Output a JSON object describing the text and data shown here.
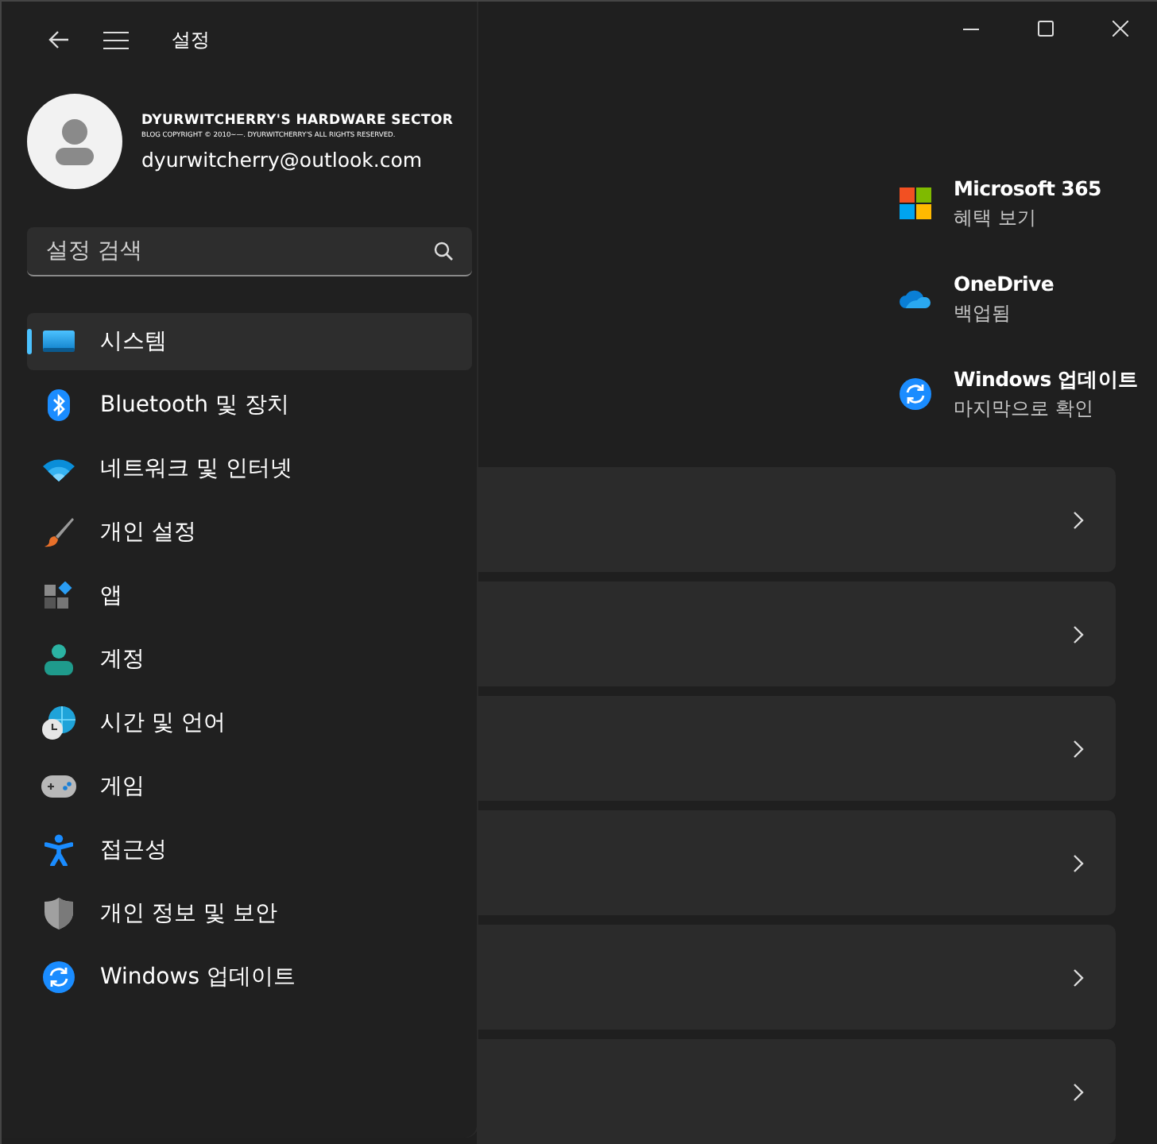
{
  "window": {
    "title": "설정"
  },
  "user": {
    "banner": "DYURWITCHERRY'S HARDWARE SECTOR",
    "banner_note": "BLOG COPYRIGHT © 2010~—. DYURWITCHERRY'S ALL RIGHTS RESERVED.",
    "email": "dyurwitcherry@outlook.com"
  },
  "search": {
    "placeholder": "설정 검색"
  },
  "nav_items": [
    {
      "label": "시스템",
      "selected": true
    },
    {
      "label": "Bluetooth 및 장치",
      "selected": false
    },
    {
      "label": "네트워크 및 인터넷",
      "selected": false
    },
    {
      "label": "개인 설정",
      "selected": false
    },
    {
      "label": "앱",
      "selected": false
    },
    {
      "label": "계정",
      "selected": false
    },
    {
      "label": "시간 및 언어",
      "selected": false
    },
    {
      "label": "게임",
      "selected": false
    },
    {
      "label": "접근성",
      "selected": false
    },
    {
      "label": "개인 정보 및 보안",
      "selected": false
    },
    {
      "label": "Windows 업데이트",
      "selected": false
    }
  ],
  "quick_links": [
    {
      "title": "Microsoft 365",
      "subtitle": "혜택 보기"
    },
    {
      "title": "OneDrive",
      "subtitle": "백업됨"
    },
    {
      "title": "Windows 업데이트",
      "subtitle": "마지막으로 확인"
    }
  ],
  "cards": [
    {
      "kind": "link"
    },
    {
      "kind": "link"
    },
    {
      "kind": "link"
    },
    {
      "kind": "link"
    },
    {
      "kind": "link"
    },
    {
      "kind": "link"
    }
  ]
}
